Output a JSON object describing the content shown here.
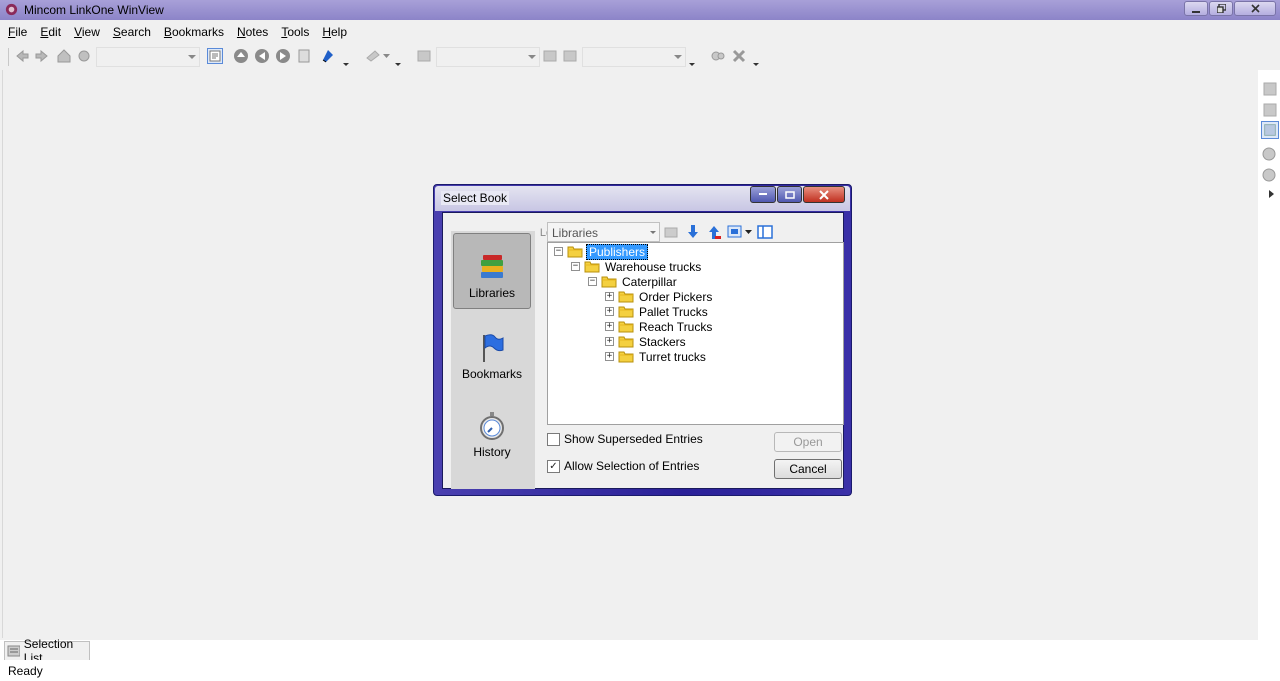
{
  "window": {
    "title": "Mincom LinkOne WinView"
  },
  "menu": {
    "items": [
      {
        "label": "File",
        "u": "F",
        "rest": "ile"
      },
      {
        "label": "Edit",
        "u": "E",
        "rest": "dit"
      },
      {
        "label": "View",
        "u": "V",
        "rest": "iew"
      },
      {
        "label": "Search",
        "u": "S",
        "rest": "earch"
      },
      {
        "label": "Bookmarks",
        "u": "B",
        "rest": "ookmarks"
      },
      {
        "label": "Notes",
        "u": "N",
        "rest": "otes"
      },
      {
        "label": "Tools",
        "u": "T",
        "rest": "ools"
      },
      {
        "label": "Help",
        "u": "H",
        "rest": "elp"
      }
    ]
  },
  "bottom": {
    "tab_label": "Selection List",
    "status": "Ready"
  },
  "dialog": {
    "title": "Select Book",
    "look_in_label": "Look In:",
    "look_in_value": "Libraries",
    "nav": {
      "libraries": "Libraries",
      "bookmarks": "Bookmarks",
      "history": "History"
    },
    "tree": [
      {
        "label": "Publishers",
        "level": 0,
        "expander": "−",
        "selected": true
      },
      {
        "label": "Warehouse trucks",
        "level": 1,
        "expander": "−",
        "selected": false
      },
      {
        "label": "Caterpillar",
        "level": 2,
        "expander": "−",
        "selected": false
      },
      {
        "label": "Order Pickers",
        "level": 3,
        "expander": "+",
        "selected": false
      },
      {
        "label": "Pallet Trucks",
        "level": 3,
        "expander": "+",
        "selected": false
      },
      {
        "label": "Reach Trucks",
        "level": 3,
        "expander": "+",
        "selected": false
      },
      {
        "label": "Stackers",
        "level": 3,
        "expander": "+",
        "selected": false
      },
      {
        "label": "Turret trucks",
        "level": 3,
        "expander": "+",
        "selected": false
      }
    ],
    "show_superseded": {
      "label": "Show Superseded Entries",
      "checked": false
    },
    "allow_selection": {
      "label": "Allow Selection of Entries",
      "checked": true
    },
    "open_label": "Open",
    "cancel_label": "Cancel"
  }
}
